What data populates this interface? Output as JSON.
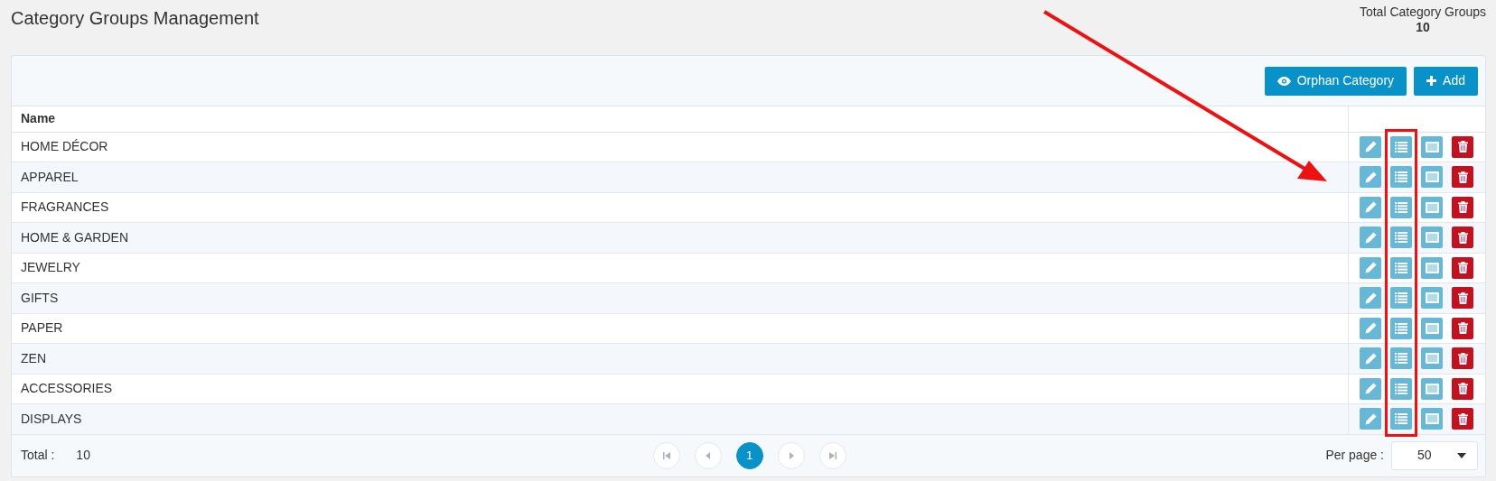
{
  "page_title": "Category Groups Management",
  "summary": {
    "label": "Total Category Groups",
    "value": "10"
  },
  "toolbar": [
    {
      "kind": "eye",
      "label": "Orphan Category"
    },
    {
      "kind": "plus",
      "label": "Add"
    }
  ],
  "table": {
    "columns": [
      "Name"
    ],
    "row_actions": [
      {
        "kind": "edit"
      },
      {
        "kind": "list"
      },
      {
        "kind": "details"
      },
      {
        "kind": "delete"
      }
    ],
    "rows": [
      {
        "name": "HOME DÉCOR"
      },
      {
        "name": "APPAREL"
      },
      {
        "name": "FRAGRANCES"
      },
      {
        "name": "HOME & GARDEN"
      },
      {
        "name": "JEWELRY"
      },
      {
        "name": "GIFTS"
      },
      {
        "name": "PAPER"
      },
      {
        "name": "ZEN"
      },
      {
        "name": "ACCESSORIES"
      },
      {
        "name": "DISPLAYS"
      }
    ]
  },
  "footer": {
    "total_label": "Total :",
    "total_value": "10",
    "pagination": [
      {
        "kind": "first",
        "selected": false
      },
      {
        "kind": "prev",
        "selected": false
      },
      {
        "kind": "page",
        "label": "1",
        "selected": true
      },
      {
        "kind": "next",
        "selected": false
      },
      {
        "kind": "last",
        "selected": false
      }
    ],
    "per_page_label": "Per page :",
    "per_page_value": "50"
  },
  "annotations": {
    "arrow": true,
    "highlight_frame": true
  }
}
